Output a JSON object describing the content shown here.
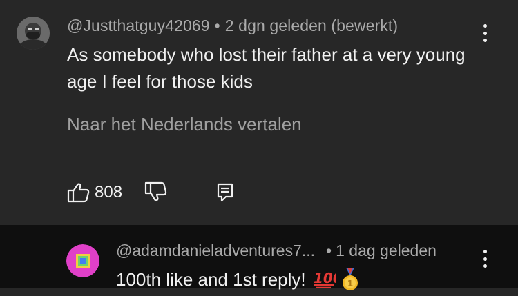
{
  "comment": {
    "author": "@Justthatguy42069",
    "separator": "•",
    "time": "2 dgn geleden (bewerkt)",
    "text": "As somebody who lost their father at a very young  age I feel for those kids",
    "translate_label": "Naar het Nederlands vertalen",
    "like_count": "808",
    "icons": {
      "avatar": "avatar-portrait",
      "like": "thumbs-up-icon",
      "dislike": "thumbs-down-icon",
      "reply": "reply-icon",
      "menu": "more-vert-icon"
    }
  },
  "reply": {
    "author": "@adamdanieladventures7...",
    "separator": "•",
    "time": "1 dag geleden",
    "text": "100th like and 1st reply!",
    "emojis": [
      "hundred-points-emoji",
      "first-place-medal-emoji"
    ]
  },
  "colors": {
    "top_background": "#272727",
    "reply_background": "#0f0f0f",
    "primary_text": "#f1f1f1",
    "secondary_text": "#aaaaaa",
    "avatar2_outer": "#e040c8",
    "avatar2_inner": "#6cd46c"
  }
}
